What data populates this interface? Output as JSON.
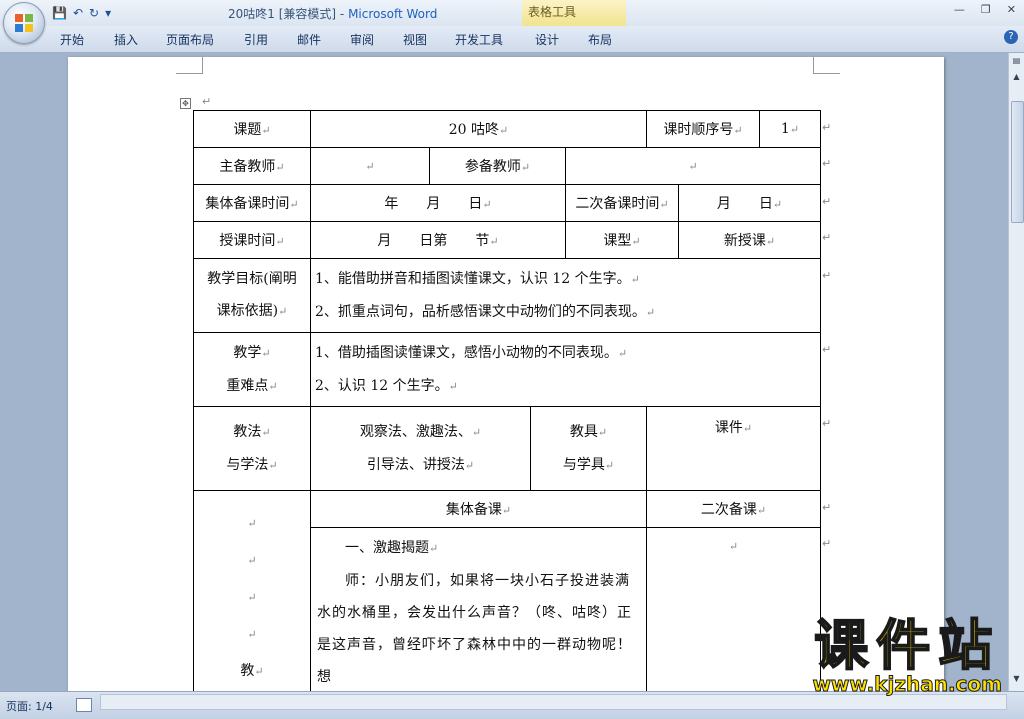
{
  "window": {
    "title": "20咕咚1 [兼容模式]",
    "title_sep": " - ",
    "app_name": "Microsoft Word",
    "context_tab_group": "表格工具"
  },
  "quick_access": {
    "save": "💾",
    "undo": "↶",
    "redo": "↻",
    "more": "▾"
  },
  "ribbon_tabs": [
    "开始",
    "插入",
    "页面布局",
    "引用",
    "邮件",
    "审阅",
    "视图",
    "开发工具",
    "设计",
    "布局"
  ],
  "status_bar": {
    "page_info": "页面: 1/4"
  },
  "watermark": {
    "logo_text": "课件站",
    "url": "www.kjzhan.com"
  },
  "lesson_plan": {
    "topic_label": "课题",
    "topic_value": "20 咕咚",
    "sequence_label": "课时顺序号",
    "sequence_value": "1",
    "lead_teacher_label": "主备教师",
    "lead_teacher_value": "",
    "co_teacher_label": "参备教师",
    "co_teacher_value": "",
    "group_prep_time_label": "集体备课时间",
    "group_prep_time_value": "年　　月　　日",
    "second_prep_time_label": "二次备课时间",
    "second_prep_time_value": "月　　日",
    "teach_time_label": "授课时间",
    "teach_time_value": "月　　日第　　节",
    "lesson_type_label": "课型",
    "lesson_type_value": "新授课",
    "goals_label_1": "教学目标(阐明",
    "goals_label_2": "课标依据)",
    "goal_1": "1、能借助拼音和插图读懂课文，认识 12 个生字。",
    "goal_2": "2、抓重点词句，品析感悟课文中动物们的不同表现。",
    "key_label_1": "教学",
    "key_label_2": "重难点",
    "key_1": "1、借助插图读懂课文，感悟小动物的不同表现。",
    "key_2": "2、认识 12 个生字。",
    "method_label_1": "教法",
    "method_label_2": "与学法",
    "method_1": "观察法、激趣法、",
    "method_2": "引导法、讲授法",
    "tool_label_1": "教具",
    "tool_label_2": "与学具",
    "tool_value": "课件",
    "group_prep_header": "集体备课",
    "second_prep_header": "二次备课",
    "process_label_char": "教",
    "section_1_title": "一、激趣揭题",
    "section_1_text": "师：小朋友们，如果将一块小石子投进装满水的水桶里，会发出什么声音？（咚、咕咚）正是这声音，曾经吓坏了森林中中的一群动物呢！想"
  }
}
